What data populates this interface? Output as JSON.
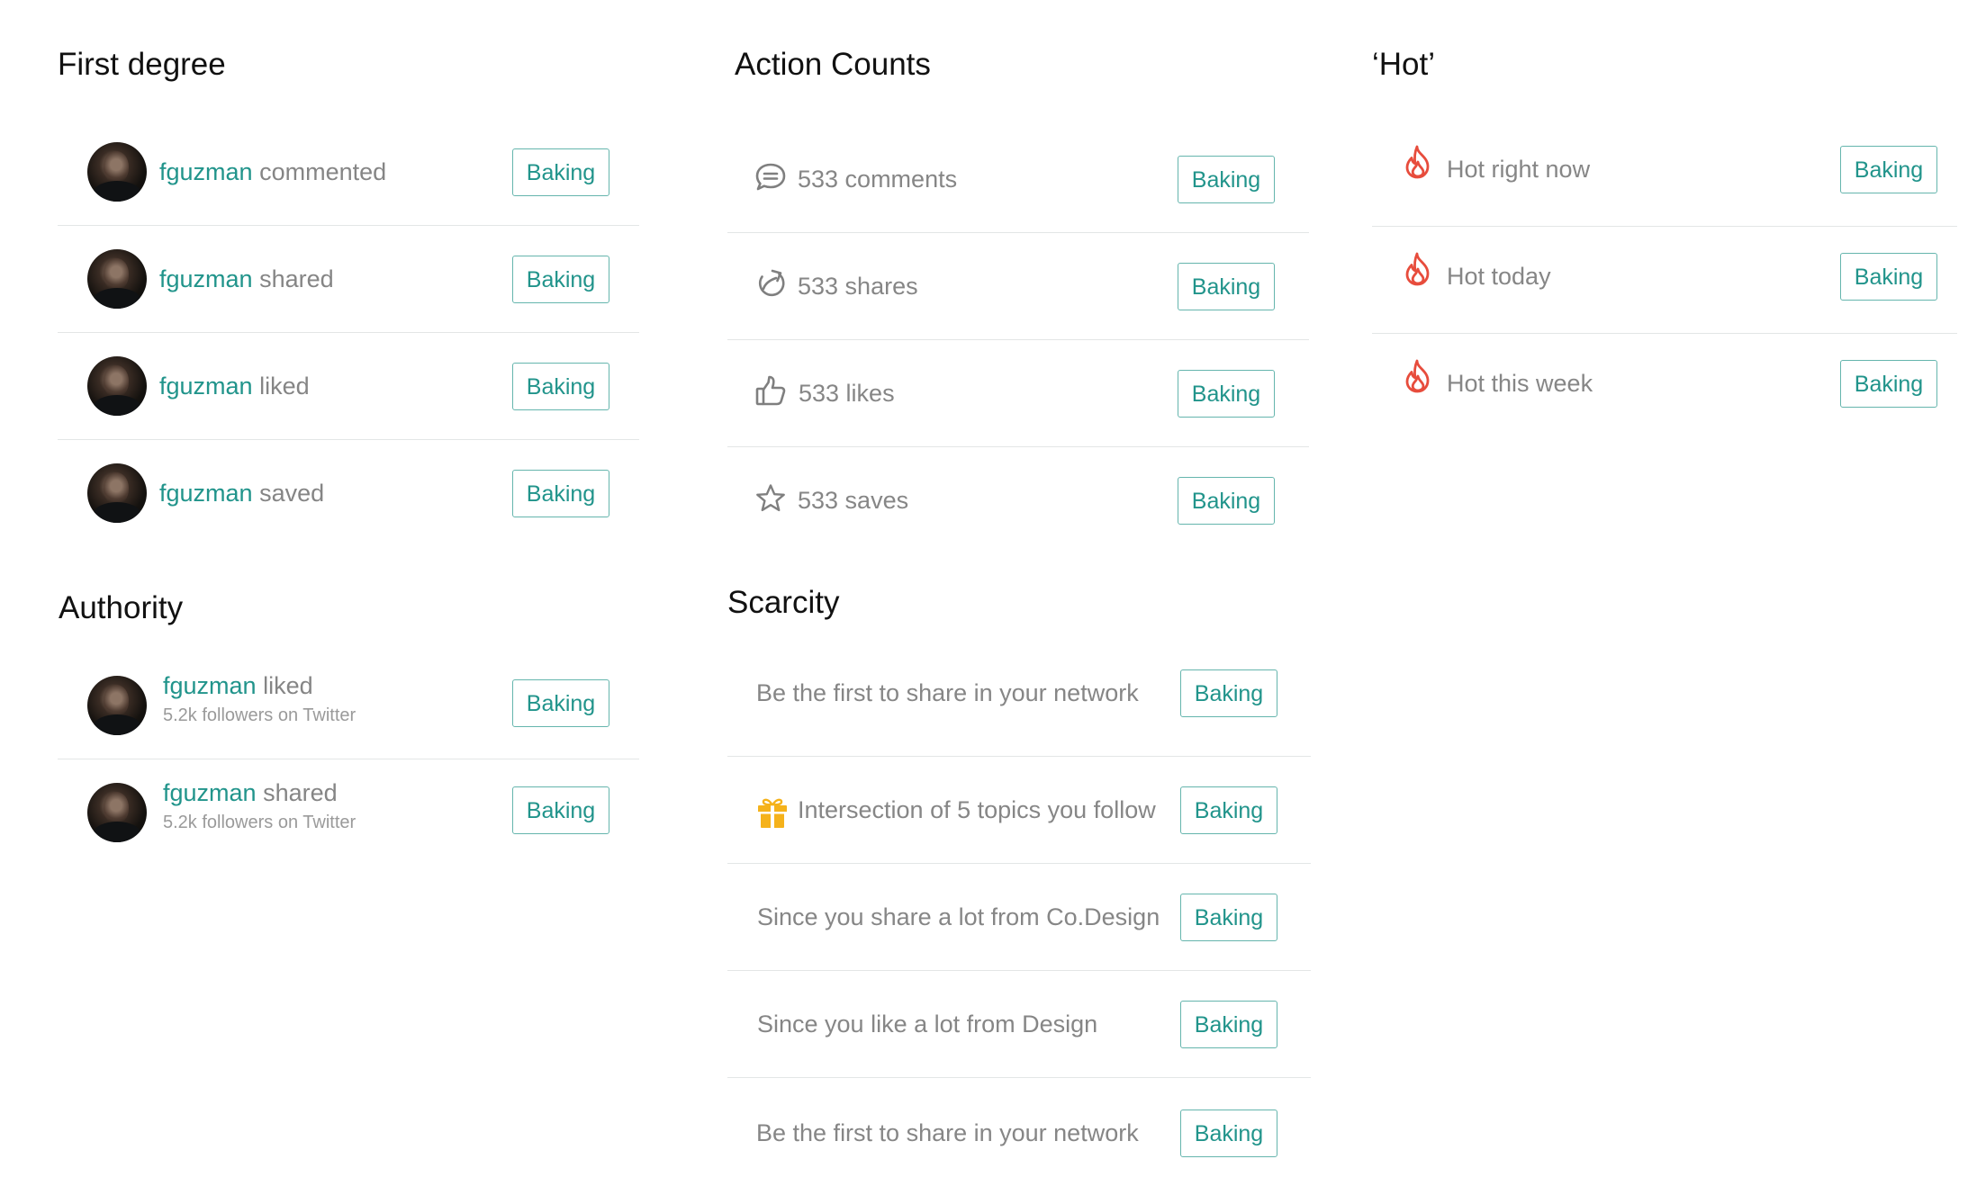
{
  "sections": {
    "first_degree": {
      "title": "First degree",
      "rows": [
        {
          "user": "fguzman",
          "action": "commented",
          "tag": "Baking"
        },
        {
          "user": "fguzman",
          "action": "shared",
          "tag": "Baking"
        },
        {
          "user": "fguzman",
          "action": "liked",
          "tag": "Baking"
        },
        {
          "user": "fguzman",
          "action": "saved",
          "tag": "Baking"
        }
      ]
    },
    "action_counts": {
      "title": "Action Counts",
      "rows": [
        {
          "icon": "comment-icon",
          "text": "533 comments",
          "tag": "Baking"
        },
        {
          "icon": "share-icon",
          "text": "533 shares",
          "tag": "Baking"
        },
        {
          "icon": "thumbs-up-icon",
          "text": "533 likes",
          "tag": "Baking"
        },
        {
          "icon": "star-icon",
          "text": "533 saves",
          "tag": "Baking"
        }
      ]
    },
    "hot": {
      "title": "‘Hot’",
      "rows": [
        {
          "icon": "flame-icon",
          "text": "Hot right now",
          "tag": "Baking"
        },
        {
          "icon": "flame-icon",
          "text": "Hot today",
          "tag": "Baking"
        },
        {
          "icon": "flame-icon",
          "text": "Hot this week",
          "tag": "Baking"
        }
      ]
    },
    "authority": {
      "title": "Authority",
      "rows": [
        {
          "user": "fguzman",
          "action": "liked",
          "subtext": "5.2k followers on Twitter",
          "tag": "Baking"
        },
        {
          "user": "fguzman",
          "action": "shared",
          "subtext": "5.2k followers on Twitter",
          "tag": "Baking"
        }
      ]
    },
    "scarcity": {
      "title": "Scarcity",
      "rows": [
        {
          "text": "Be the first to share in your network",
          "tag": "Baking"
        },
        {
          "icon": "gift-icon",
          "text": "Intersection of 5 topics you follow",
          "tag": "Baking"
        },
        {
          "text": "Since you share a lot from Co.Design",
          "tag": "Baking"
        },
        {
          "text": "Since you like a lot from Design",
          "tag": "Baking"
        },
        {
          "text": "Be the first to share in your network",
          "tag": "Baking"
        }
      ]
    }
  },
  "colors": {
    "accent": "#21948b",
    "button_border": "#65b5ad",
    "body_text": "#868686",
    "divider": "#e3e6e6",
    "flame": "#e74c3c",
    "gift": "#f5b21b"
  }
}
